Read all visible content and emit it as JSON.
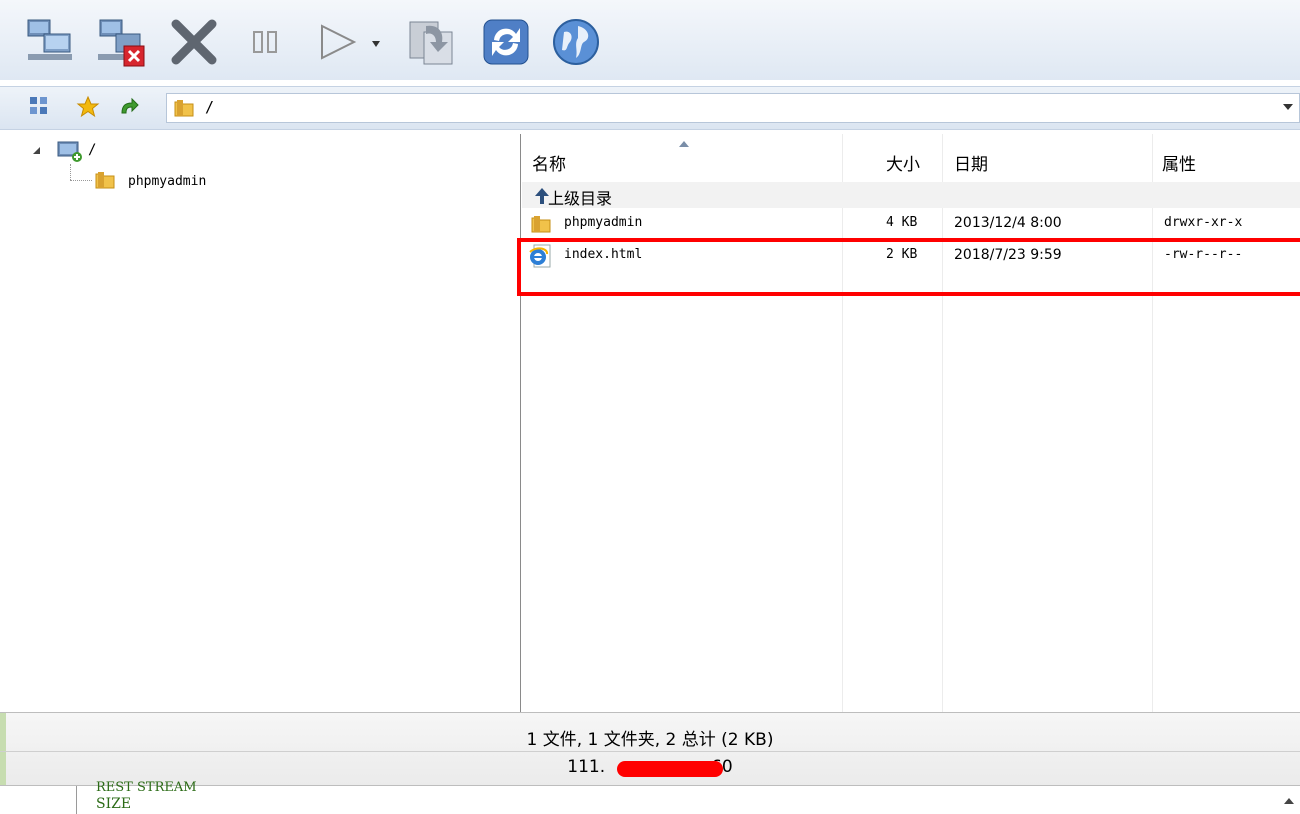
{
  "address_bar": {
    "path": "/"
  },
  "tree": {
    "root_label": "/",
    "child_label": "phpmyadmin"
  },
  "list": {
    "columns": {
      "name": "名称",
      "size": "大小",
      "date": "日期",
      "attributes": "属性"
    },
    "parent_dir_label": "上级目录",
    "rows": [
      {
        "name": "phpmyadmin",
        "size": "4 KB",
        "date": "2013/12/4 8:00",
        "attributes": "drwxr-xr-x",
        "type": "folder"
      },
      {
        "name": "index.html",
        "size": "2 KB",
        "date": "2018/7/23 9:59",
        "attributes": "-rw-r--r--",
        "type": "html"
      }
    ]
  },
  "status": {
    "summary": "1 文件, 1 文件夹, 2 总计 (2 KB)",
    "address_prefix": "111.",
    "address_suffix": "60"
  },
  "log": {
    "line1": "REST STREAM",
    "line2": "SIZE"
  },
  "colors": {
    "highlight": "#ff0000",
    "log_text": "#2b6b16"
  }
}
